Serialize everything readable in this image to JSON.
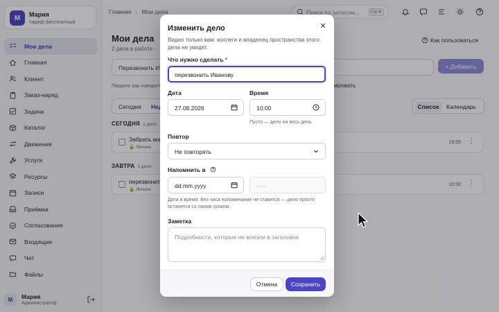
{
  "colors": {
    "accent": "#4b44c7",
    "sidebar_active": "#3d36b8",
    "required": "#d33333"
  },
  "profile": {
    "initial": "М",
    "name": "Мария",
    "plan": "тариф Бесплатный"
  },
  "sidebar": {
    "items": [
      {
        "label": "Мои дела",
        "icon": "checklist-icon",
        "active": true
      },
      {
        "label": "Главная",
        "icon": "home-icon"
      },
      {
        "label": "Клиент",
        "icon": "users-icon"
      },
      {
        "label": "Заказ-наряд",
        "icon": "clipboard-icon"
      },
      {
        "label": "Задачи",
        "icon": "tasks-icon"
      },
      {
        "label": "Каталог",
        "icon": "box-icon"
      },
      {
        "label": "Движения",
        "icon": "arrows-icon"
      },
      {
        "label": "Услуги",
        "icon": "wrench-icon"
      },
      {
        "label": "Ресурсы",
        "icon": "stack-icon"
      },
      {
        "label": "Записи",
        "icon": "calendar-icon"
      },
      {
        "label": "Приёмка",
        "icon": "inbox-icon"
      },
      {
        "label": "Согласования",
        "icon": "approve-icon"
      },
      {
        "label": "Входящие",
        "icon": "mail-icon"
      },
      {
        "label": "Чат",
        "icon": "chat-icon"
      },
      {
        "label": "Файлы",
        "icon": "folder-icon"
      }
    ]
  },
  "footer_user": {
    "initial": "М",
    "name": "Мария",
    "role": "Администратор"
  },
  "topbar": {
    "breadcrumb": [
      "Главная",
      "Мои дела"
    ],
    "search_placeholder": "Поиск по записям...",
    "search_shortcut": "Ctrl K"
  },
  "page": {
    "title": "Мои дела",
    "subtitle": "2 дела в работе · ",
    "howto": "Как пользоваться",
    "quick_input": "Перезвонить И",
    "add_button": "+ Добавить",
    "hint": "Пишите как говорите",
    "hint_right": "ировать",
    "filter_tabs": [
      "Сегодня",
      "Нед"
    ],
    "view_tabs": [
      "Список",
      "Календарь"
    ],
    "sections": [
      {
        "title": "СЕГОДНЯ",
        "count": "1 дело",
        "task": {
          "title": "Забрать ма",
          "tag": "Личное",
          "time": "16:00"
        }
      },
      {
        "title": "ЗАВТРА",
        "count": "1 дело",
        "task": {
          "title": "перезвонить",
          "tag": "Личное",
          "time": "10:00"
        }
      }
    ]
  },
  "modal": {
    "title": "Изменить дело",
    "description": "Видно только вам: коллеги и владелец пространства этого дела не увидят.",
    "what_label": "Что нужно сделать",
    "what_required": "*",
    "what_value": "перезвонить Иванову",
    "date_label": "Дата",
    "date_value": "27.08.2026",
    "time_label": "Время",
    "time_value": "10:00",
    "time_help": "Пусто — дело на весь день",
    "repeat_label": "Повтор",
    "repeat_value": "Не повторять",
    "remind_label": "Напомнить в",
    "remind_date_placeholder": "dd.mm.yyyy",
    "remind_time_placeholder": "--:--",
    "remind_help": "Дата и время. Без часа напоминание не ставится — дело просто останется со своим сроком.",
    "note_label": "Заметка",
    "note_placeholder": "Подробности, которые не влезли в заголовок",
    "cancel": "Отмена",
    "save": "Сохранить"
  }
}
